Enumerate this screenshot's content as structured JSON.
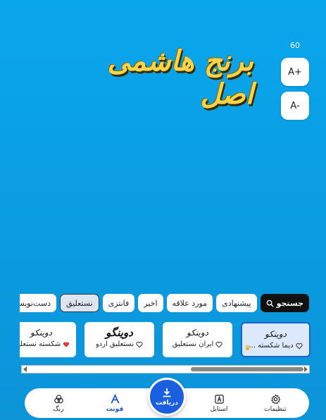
{
  "size_readout": "60",
  "zoom": {
    "in_label": "A+",
    "out_label": "A-"
  },
  "preview": {
    "text": "برنج هاشمی اصل",
    "fill_color": "#f7d44a"
  },
  "categories": {
    "search_label": "جستجو",
    "items": [
      {
        "label": "پیشنهادی"
      },
      {
        "label": "مورد علاقه"
      },
      {
        "label": "اخیر"
      },
      {
        "label": "فانتزی"
      },
      {
        "label": "نستعلیق",
        "active": true
      },
      {
        "label": "دست‌نویس"
      }
    ]
  },
  "fonts": [
    {
      "sample": "دوینکو",
      "label": "دیما شکسته ...",
      "favorite": false,
      "premium": true,
      "selected": true
    },
    {
      "sample": "دوینکو",
      "label": "ایران نستعلیق",
      "favorite": false,
      "premium": false,
      "selected": false
    },
    {
      "sample": "دوینگو",
      "label": "نستعلیق اردو",
      "favorite": false,
      "premium": false,
      "selected": false
    },
    {
      "sample": "دوینکو",
      "label": "شکسته نستعلیق",
      "favorite": true,
      "premium": false,
      "selected": false
    }
  ],
  "nav": {
    "settings": "تنظیمات",
    "style": "استایل",
    "download": "دریافت",
    "font": "فونت",
    "color": "رنگ"
  },
  "colors": {
    "accent": "#1a5fe0",
    "background": "#0aa6ec",
    "favorite": "#e53935",
    "premium": "#f0a500"
  }
}
